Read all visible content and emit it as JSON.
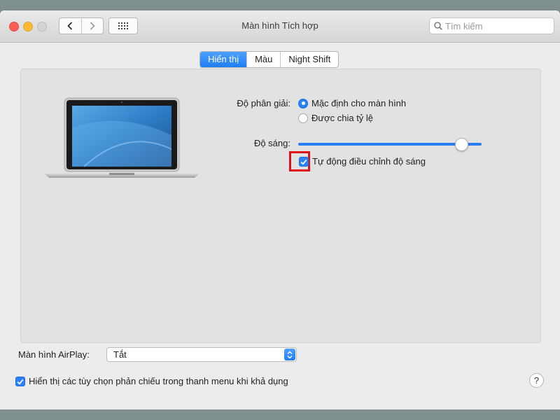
{
  "window": {
    "title": "Màn hình Tích hợp",
    "search_placeholder": "Tìm kiếm"
  },
  "toolbar": {
    "back_icon": "chevron-left-icon",
    "forward_icon": "chevron-right-icon",
    "grid_icon": "grid-icon"
  },
  "tabs": [
    {
      "label": "Hiển thị",
      "active": true
    },
    {
      "label": "Màu",
      "active": false
    },
    {
      "label": "Night Shift",
      "active": false
    }
  ],
  "display": {
    "resolution_label": "Độ phân giải:",
    "resolution_options": [
      {
        "label": "Mặc định cho màn hình",
        "selected": true
      },
      {
        "label": "Được chia tỷ lệ",
        "selected": false
      }
    ],
    "brightness_label": "Độ sáng:",
    "brightness_level": 0.92,
    "auto_brightness_label": "Tự động điều chỉnh độ sáng",
    "auto_brightness_checked": true
  },
  "footer": {
    "airplay_label": "Màn hình AirPlay:",
    "airplay_value": "Tắt",
    "mirror_label": "Hiển thị các tùy chọn phản chiếu trong thanh menu khi khả dụng",
    "mirror_checked": true,
    "help_label": "?"
  },
  "colors": {
    "accent": "#2a82f6",
    "highlight_box": "#e10f1c"
  }
}
